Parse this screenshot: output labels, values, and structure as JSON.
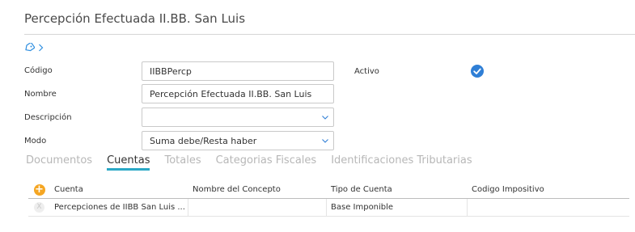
{
  "header": {
    "title": "Percepción Efectuada II.BB. San Luis"
  },
  "icons": {
    "tag": "tag-icon",
    "chevron": "chevron-right-icon",
    "check": "checkmark-circle-icon",
    "dropdown": "chevron-down-icon"
  },
  "form": {
    "codigo_label": "Código",
    "codigo_value": "IIBBPercp",
    "nombre_label": "Nombre",
    "nombre_value": "Percepción Efectuada II.BB. San Luis",
    "descripcion_label": "Descripción",
    "descripcion_value": "",
    "modo_label": "Modo",
    "modo_value": "Suma debe/Resta haber",
    "activo_label": "Activo",
    "activo_checked": true
  },
  "tabs": [
    {
      "label": "Documentos",
      "active": false
    },
    {
      "label": "Cuentas",
      "active": true
    },
    {
      "label": "Totales",
      "active": false
    },
    {
      "label": "Categorias Fiscales",
      "active": false
    },
    {
      "label": "Identificaciones Tributarias",
      "active": false
    }
  ],
  "grid": {
    "add_symbol": "+",
    "delete_symbol": "X",
    "columns": [
      "Cuenta",
      "Nombre del Concepto",
      "Tipo de Cuenta",
      "Codigo Impositivo"
    ],
    "rows": [
      [
        "Percepciones de IIBB San Luis ...",
        "",
        "Base Imponible",
        ""
      ]
    ]
  },
  "colors": {
    "accent": "#2f7fd6",
    "tab_underline": "#2aa8c6",
    "add_button": "#f5a623"
  }
}
